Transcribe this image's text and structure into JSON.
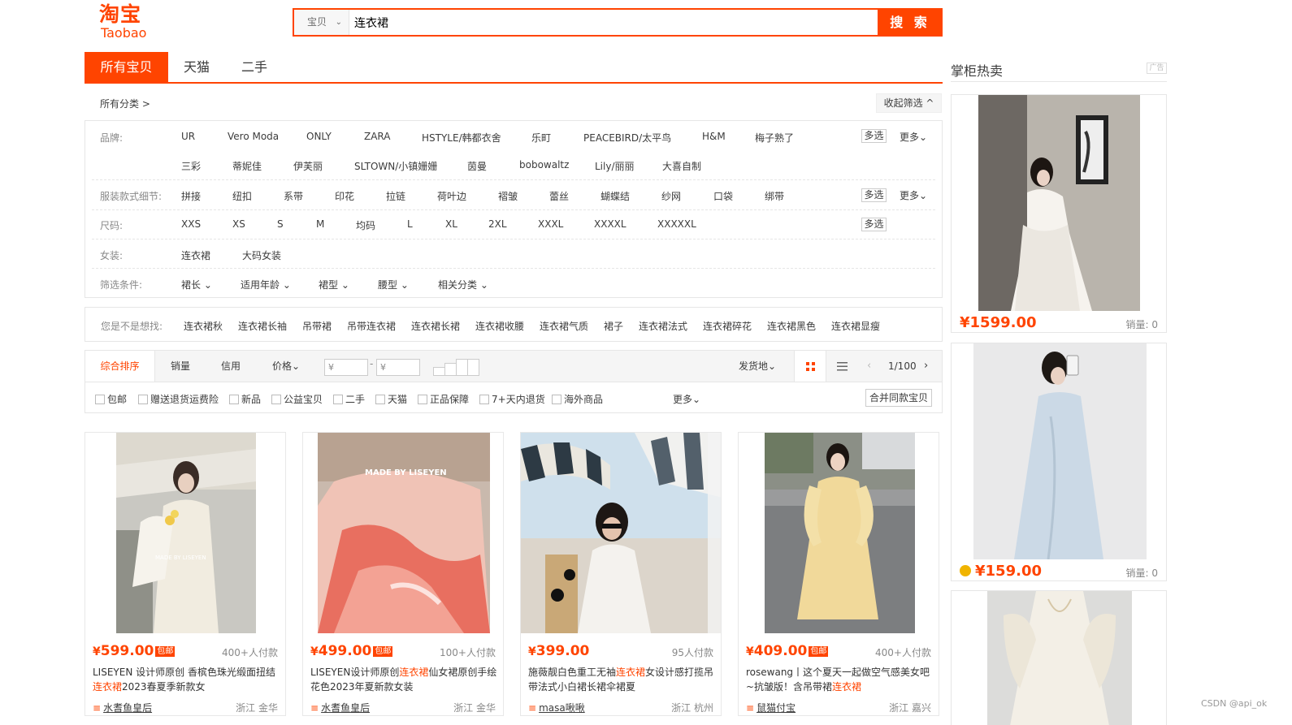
{
  "header": {
    "logo_cn": "淘宝",
    "logo_en": "Taobao",
    "search_type": "宝贝",
    "search_value": "连衣裙",
    "search_button": "搜 索"
  },
  "tabs": [
    "所有宝贝",
    "天猫",
    "二手"
  ],
  "breadcrumb": "所有分类 >",
  "collapse_filter": "收起筛选 ^",
  "filters": {
    "brand_label": "品牌:",
    "brands_row1": [
      "UR",
      "Vero Moda",
      "ONLY",
      "ZARA",
      "HSTYLE/韩都衣舍",
      "乐町",
      "PEACEBIRD/太平鸟",
      "H&M",
      "梅子熟了"
    ],
    "brands_row2": [
      "三彩",
      "蒂妮佳",
      "伊芙丽",
      "SLTOWN/小镇姗姗",
      "茵曼",
      "bobowaltz",
      "Lily/丽丽",
      "大喜自制"
    ],
    "detail_label": "服装款式细节:",
    "details": [
      "拼接",
      "纽扣",
      "系带",
      "印花",
      "拉链",
      "荷叶边",
      "褶皱",
      "蕾丝",
      "蝴蝶结",
      "纱网",
      "口袋",
      "绑带"
    ],
    "size_label": "尺码:",
    "sizes": [
      "XXS",
      "XS",
      "S",
      "M",
      "均码",
      "L",
      "XL",
      "2XL",
      "XXXL",
      "XXXXL",
      "XXXXXL"
    ],
    "women_label": "女装:",
    "women": [
      "连衣裙",
      "大码女装"
    ],
    "cond_label": "筛选条件:",
    "conditions": [
      "裙长 ⌄",
      "适用年龄 ⌄",
      "裙型 ⌄",
      "腰型 ⌄",
      "相关分类 ⌄"
    ],
    "multi": "多选",
    "more": "更多⌄"
  },
  "guess": {
    "label": "您是不是想找:",
    "items": [
      "连衣裙秋",
      "连衣裙长袖",
      "吊带裙",
      "吊带连衣裙",
      "连衣裙长裙",
      "连衣裙收腰",
      "连衣裙气质",
      "裙子",
      "连衣裙法式",
      "连衣裙碎花",
      "连衣裙黑色",
      "连衣裙显瘦"
    ]
  },
  "sort": {
    "items": [
      "综合排序",
      "销量",
      "信用",
      "价格⌄"
    ],
    "price_from": "¥",
    "price_to": "¥",
    "ship_from": "发货地⌄",
    "page": "1/100"
  },
  "options": {
    "checks": [
      "包邮",
      "赠送退货运费险",
      "新品",
      "公益宝贝",
      "二手",
      "天猫",
      "正品保障",
      "7+天内退货",
      "海外商品"
    ],
    "more": "更多⌄",
    "merge": "合并同款宝贝"
  },
  "products": [
    {
      "price": "599.00",
      "badge": "包邮",
      "deals": "400+人付款",
      "title_a": "LISEYEN 设计师原创 香槟色珠光缎面扭结",
      "title_hl": "连衣裙",
      "title_b": "2023春夏季新款女",
      "shop": "水耆鱼皇后",
      "loc": "浙江 金华"
    },
    {
      "price": "499.00",
      "badge": "包邮",
      "deals": "100+人付款",
      "title_a": "LISEYEN设计师原创",
      "title_hl": "连衣裙",
      "title_b": "仙女裙原创手绘花色2023年夏新款女装",
      "shop": "水耆鱼皇后",
      "loc": "浙江 金华"
    },
    {
      "price": "399.00",
      "badge": "",
      "deals": "95人付款",
      "title_a": "施薇靓白色重工无袖",
      "title_hl": "连衣裙",
      "title_b": "女设计感打揽吊带法式小白裙长裙伞裙夏",
      "shop": "masa啾啾",
      "loc": "浙江 杭州"
    },
    {
      "price": "409.00",
      "badge": "包邮",
      "deals": "400+人付款",
      "title_a": "rosewang丨这个夏天一起做空气感美女吧~抗皱版！含吊带裙",
      "title_hl": "连衣裙",
      "title_b": "",
      "shop": "鼠猫付宝",
      "loc": "浙江 嘉兴"
    }
  ],
  "rail": {
    "title": "掌柜热卖",
    "ad": "广告",
    "items": [
      {
        "price": "1599.00",
        "sales": "销量: 0"
      },
      {
        "price": "159.00",
        "sales": "销量: 0"
      }
    ]
  },
  "watermark": "CSDN @api_ok",
  "colors": {
    "accent": "#ff4400"
  }
}
